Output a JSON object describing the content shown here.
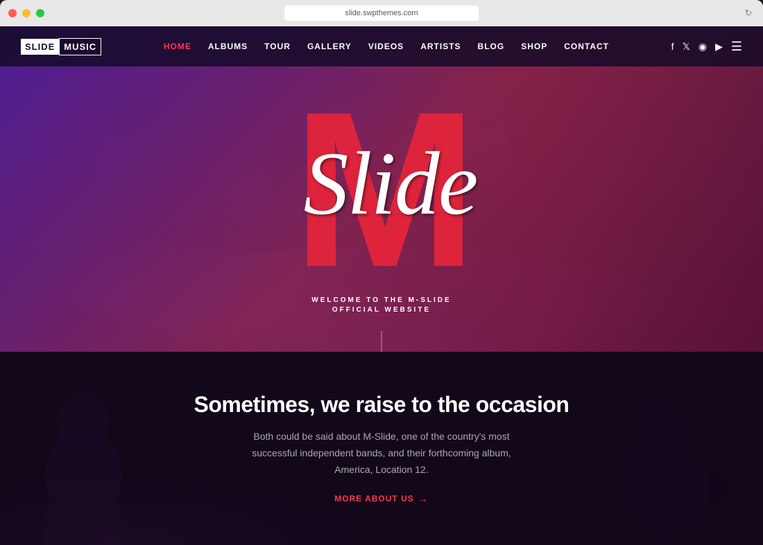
{
  "browser": {
    "url": "slide.swpthemes.com",
    "refresh_icon": "↻"
  },
  "logo": {
    "slide": "SLIDE",
    "music": "MUSIC"
  },
  "nav": {
    "links": [
      {
        "label": "HOME",
        "active": true
      },
      {
        "label": "ALBUMS",
        "active": false
      },
      {
        "label": "TOUR",
        "active": false
      },
      {
        "label": "GALLERY",
        "active": false
      },
      {
        "label": "VIDEOS",
        "active": false
      },
      {
        "label": "ARTISTS",
        "active": false
      },
      {
        "label": "BLOG",
        "active": false
      },
      {
        "label": "SHOP",
        "active": false
      },
      {
        "label": "CONTACT",
        "active": false
      }
    ],
    "social": [
      "f",
      "t",
      "ig",
      "yt"
    ]
  },
  "hero": {
    "big_letter": "M",
    "script_text": "Slide",
    "welcome_line1": "WELCOME TO THE M-SLIDE",
    "welcome_line2": "OFFICIAL WEBSITE"
  },
  "about": {
    "heading": "Sometimes, we raise to the occasion",
    "body": "Both could be said about M-Slide, one of the country's most successful independent bands, and their forthcoming album, America, Location 12.",
    "link_label": "MORE ABOUT US",
    "link_arrow": "→"
  }
}
